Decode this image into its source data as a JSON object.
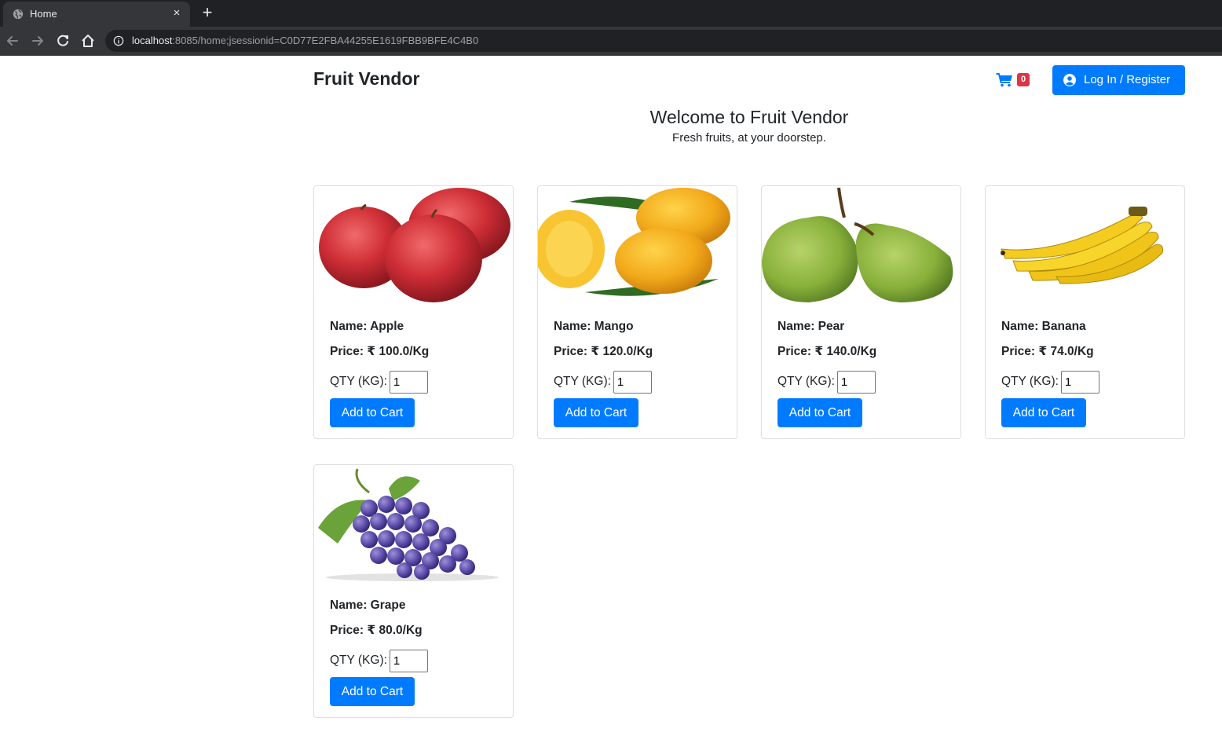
{
  "browser": {
    "tab_title": "Home",
    "tab_close": "×",
    "new_tab": "+",
    "url_host": "localhost",
    "url_rest": ":8085/home;jsessionid=C0D77E2FBA44255E1619FBB9BFE4C4B0"
  },
  "header": {
    "brand": "Fruit Vendor",
    "cart_count": "0",
    "login_label": "Log In / Register"
  },
  "hero": {
    "title": "Welcome to Fruit Vendor",
    "subtitle": "Fresh fruits, at your doorstep."
  },
  "products": [
    {
      "name": "Name: Apple",
      "price": "Price: ₹ 100.0/Kg",
      "qty_label": "QTY (KG):",
      "qty": "1",
      "button": "Add to Cart"
    },
    {
      "name": "Name: Mango",
      "price": "Price: ₹ 120.0/Kg",
      "qty_label": "QTY (KG):",
      "qty": "1",
      "button": "Add to Cart"
    },
    {
      "name": "Name: Pear",
      "price": "Price: ₹ 140.0/Kg",
      "qty_label": "QTY (KG):",
      "qty": "1",
      "button": "Add to Cart"
    },
    {
      "name": "Name: Banana",
      "price": "Price: ₹ 74.0/Kg",
      "qty_label": "QTY (KG):",
      "qty": "1",
      "button": "Add to Cart"
    },
    {
      "name": "Name: Grape",
      "price": "Price: ₹ 80.0/Kg",
      "qty_label": "QTY (KG):",
      "qty": "1",
      "button": "Add to Cart"
    }
  ],
  "colors": {
    "primary": "#007bff",
    "badge": "#dc3545",
    "text": "#212529"
  }
}
